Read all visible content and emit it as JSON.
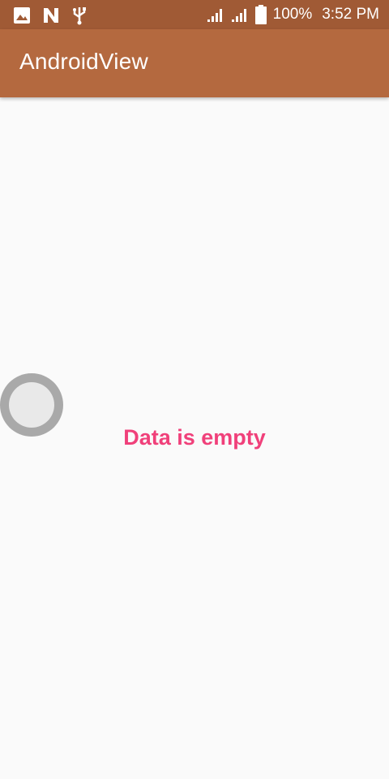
{
  "status_bar": {
    "battery_percent": "100%",
    "time": "3:52 PM",
    "icons": [
      "image-icon",
      "n-icon",
      "usb-icon",
      "signal-icon",
      "signal-icon",
      "battery-icon"
    ]
  },
  "app_bar": {
    "title": "AndroidView"
  },
  "content": {
    "empty_message": "Data is empty"
  },
  "colors": {
    "status_bar": "#a05a35",
    "app_bar": "#b4693f",
    "empty_message": "#f0407a",
    "background": "#fafafa"
  }
}
